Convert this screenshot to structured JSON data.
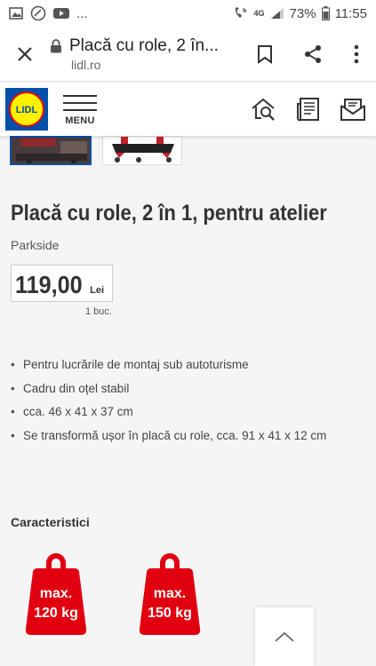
{
  "status_bar": {
    "dots": "...",
    "network": "4G",
    "battery": "73%",
    "time": "11:55"
  },
  "browser": {
    "tab_title": "Placă cu role, 2 în...",
    "host": "lidl.ro"
  },
  "header": {
    "logo_text": "LIDL",
    "menu_label": "MENU"
  },
  "product": {
    "title": "Placă cu role, 2 în 1, pentru atelier",
    "brand": "Parkside",
    "price": "119,00",
    "currency": "Lei",
    "unit": "1 buc.",
    "features": [
      "Pentru lucrările de montaj sub autoturisme",
      "Cadru din oțel stabil",
      "cca. 46 x 41 x 37 cm",
      "Se transformă ușor  în placă cu role, cca. 91 x 41 x 12 cm"
    ]
  },
  "characteristics": {
    "title": "Caracteristici",
    "badges": [
      {
        "line1": "max.",
        "line2": "120 kg"
      },
      {
        "line1": "max.",
        "line2": "150 kg"
      }
    ]
  },
  "colors": {
    "lidl_blue": "#0050aa",
    "lidl_yellow": "#fff000",
    "lidl_red": "#e60a14",
    "weight_red": "#e1000f"
  }
}
